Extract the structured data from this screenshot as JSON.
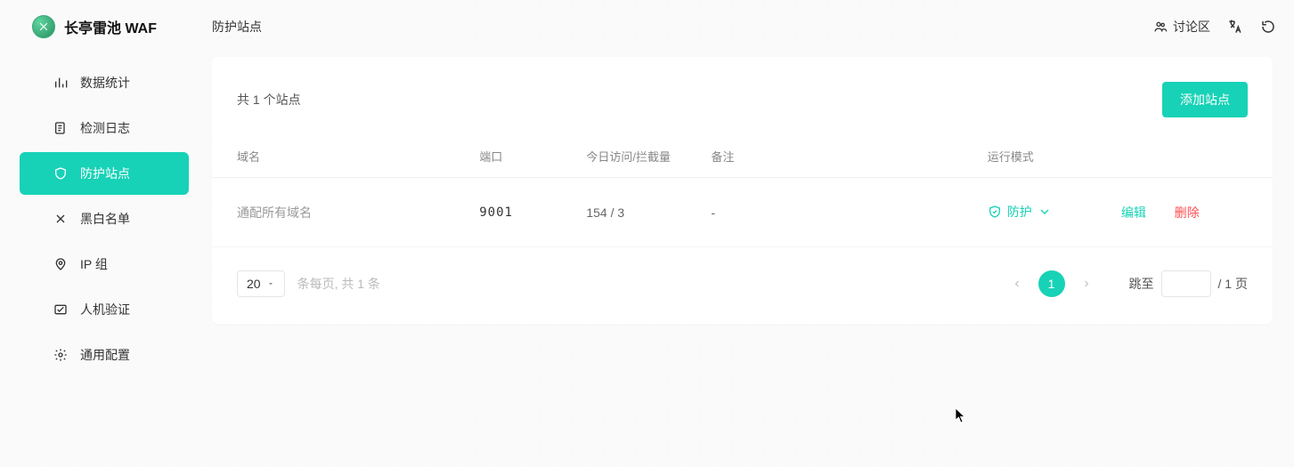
{
  "header": {
    "app_title": "长亭雷池 WAF",
    "page_title": "防护站点",
    "forum_label": "讨论区"
  },
  "sidebar": {
    "items": [
      {
        "label": "数据统计"
      },
      {
        "label": "检测日志"
      },
      {
        "label": "防护站点"
      },
      {
        "label": "黑白名单"
      },
      {
        "label": "IP 组"
      },
      {
        "label": "人机验证"
      },
      {
        "label": "通用配置"
      }
    ]
  },
  "main": {
    "summary": "共 1 个站点",
    "add_button": "添加站点",
    "columns": {
      "domain": "域名",
      "port": "端口",
      "visit": "今日访问/拦截量",
      "note": "备注",
      "mode": "运行模式"
    },
    "rows": [
      {
        "domain": "通配所有域名",
        "port": "9001",
        "visit": "154 / 3",
        "note": "-",
        "mode": "防护"
      }
    ],
    "actions": {
      "edit": "编辑",
      "delete": "删除"
    }
  },
  "pagination": {
    "page_size": "20",
    "meta": "条每页, 共 1 条",
    "current_page": "1",
    "jump_label": "跳至",
    "jump_suffix": "/ 1 页"
  }
}
